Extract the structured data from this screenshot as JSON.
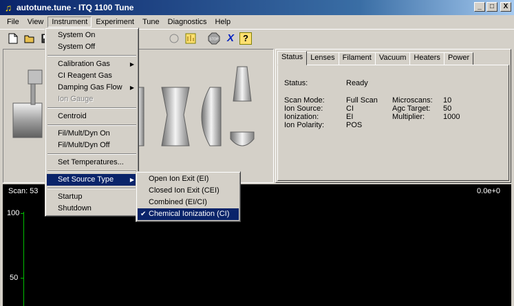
{
  "window": {
    "title": "autotune.tune - ITQ 1100 Tune",
    "app_icon": "music-note-icon"
  },
  "window_buttons": {
    "minimize": "_",
    "maximize": "□",
    "close": "X"
  },
  "menubar": [
    "File",
    "View",
    "Instrument",
    "Experiment",
    "Tune",
    "Diagnostics",
    "Help"
  ],
  "toolbar": {
    "buttons": [
      "new-file-icon",
      "open-folder-icon",
      "save-icon",
      "stop-icon",
      "x-icon",
      "help-icon"
    ],
    "stop_label": "STOP",
    "x_label": "X",
    "help_label": "?"
  },
  "instrument_menu": {
    "items": [
      {
        "label": "System On"
      },
      {
        "label": "System Off"
      },
      {
        "label": "Calibration Gas",
        "submenu": true
      },
      {
        "label": "CI Reagent Gas"
      },
      {
        "label": "Damping Gas Flow",
        "submenu": true
      },
      {
        "label": "Ion Gauge",
        "disabled": true
      },
      {
        "label": "Centroid"
      },
      {
        "label": "Fil/Mult/Dyn On"
      },
      {
        "label": "Fil/Mult/Dyn Off"
      },
      {
        "label": "Set Temperatures..."
      },
      {
        "label": "Set Source Type",
        "submenu": true,
        "highlighted": true
      },
      {
        "label": "Startup"
      },
      {
        "label": "Shutdown"
      }
    ]
  },
  "source_type_submenu": {
    "items": [
      {
        "label": "Open Ion Exit (EI)"
      },
      {
        "label": "Closed Ion Exit (CEI)"
      },
      {
        "label": "Combined (EI/CI)"
      },
      {
        "label": "Chemical Ionization (CI)",
        "checked": true,
        "highlighted": true
      }
    ]
  },
  "status_panel": {
    "tabs": [
      "Status",
      "Lenses",
      "Filament",
      "Vacuum",
      "Heaters",
      "Power"
    ],
    "active_tab": "Status",
    "status_label": "Status:",
    "status_value": "Ready",
    "left_fields": [
      {
        "label": "Scan Mode:",
        "value": "Full Scan"
      },
      {
        "label": "Ion Source:",
        "value": "CI"
      },
      {
        "label": "Ionization:",
        "value": "EI"
      },
      {
        "label": "Ion Polarity:",
        "value": "POS"
      }
    ],
    "right_fields": [
      {
        "label": "Microscans:",
        "value": "10"
      },
      {
        "label": "Agc Target:",
        "value": "50"
      },
      {
        "label": "Multiplier:",
        "value": "1000"
      }
    ]
  },
  "scan": {
    "scan_label": "Scan: 53",
    "intensity_label": "0.0e+0",
    "y_ticks": [
      "100",
      "50"
    ],
    "axis_color": "#00c000"
  },
  "colors": {
    "highlight": "#0a246a",
    "face": "#d4d0c8",
    "scan_bg": "#000000"
  }
}
